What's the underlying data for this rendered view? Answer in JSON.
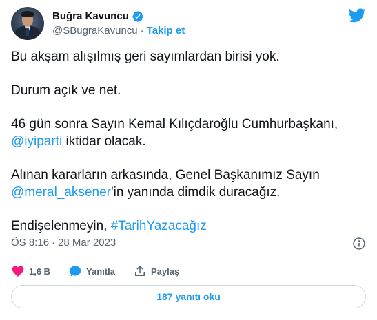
{
  "author": {
    "name": "Buğra Kavuncu",
    "handle": "@SBugraKavuncu",
    "follow_label": "Takip et",
    "dot": "·"
  },
  "tweet": {
    "line1": "Bu akşam alışılmış geri sayımlardan birisi yok.",
    "line2": "Durum açık ve net.",
    "line3a": "46 gün sonra Sayın Kemal Kılıçdaroğlu Cumhurbaşkanı,",
    "mention1": "@iyiparti",
    "line3b": " iktidar olacak.",
    "line4a": "Alınan kararların arkasında, Genel Başkanımız Sayın",
    "mention2": "@meral_aksener",
    "line4b": "'in yanında dimdik duracağız.",
    "line5a": "Endişelenmeyin, ",
    "hashtag": "#TarihYazacağız"
  },
  "meta": {
    "time": "ÖS 8:16",
    "sep": "·",
    "date": "28 Mar 2023"
  },
  "actions": {
    "likes": "1,6 B",
    "reply_label": "Yanıtla",
    "share_label": "Paylaş"
  },
  "replies_button": "187 yanıtı oku",
  "colors": {
    "accent": "#1d9bf0",
    "like": "#f91880",
    "text": "#0f1419",
    "muted": "#536471"
  },
  "icons": [
    "verified-badge-icon",
    "twitter-bird-icon",
    "info-icon",
    "heart-icon",
    "reply-bubble-icon",
    "share-icon"
  ]
}
